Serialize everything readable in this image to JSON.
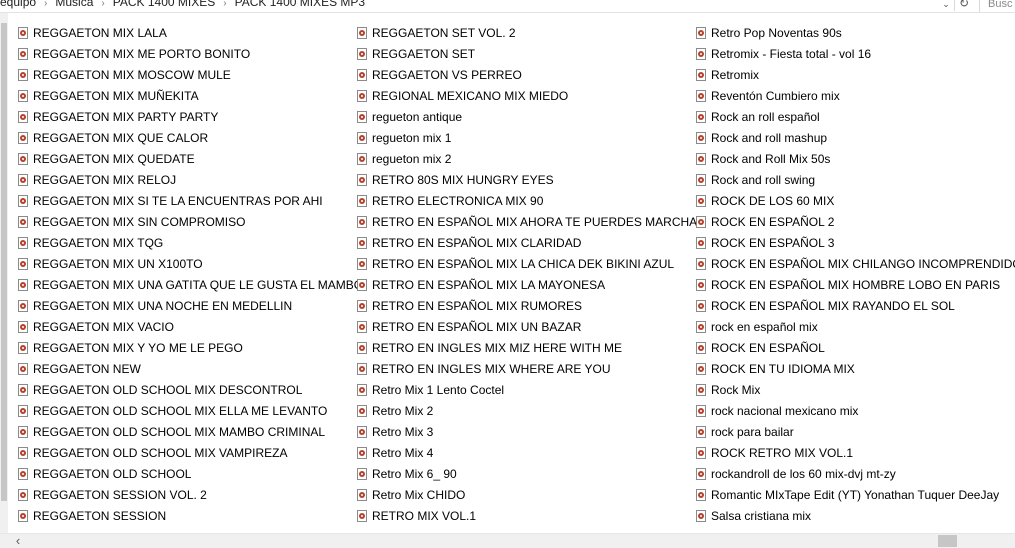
{
  "address_bar": {
    "breadcrumbs": [
      "equipo",
      "Música",
      "PACK 1400 MIXES",
      "PACK 1400 MIXES MP3"
    ],
    "search_placeholder": "Busc"
  },
  "icons": {
    "file": "audio-file-icon",
    "breadcrumb_separator": "chevron-right-icon",
    "address_dropdown": "chevron-down-icon",
    "refresh": "refresh-icon",
    "scroll_left": "chevron-left-icon"
  },
  "colors": {
    "icon_accent": "#b5422c",
    "scrollbar_thumb": "#c6c6c6",
    "scrollbar_track": "#f0f0f0"
  },
  "files": {
    "column_1": [
      "REGGAETON MIX LALA",
      "REGGAETON MIX ME PORTO BONITO",
      "REGGAETON MIX MOSCOW MULE",
      "REGGAETON MIX MUÑEKITA",
      "REGGAETON MIX PARTY PARTY",
      "REGGAETON MIX QUE CALOR",
      "REGGAETON MIX QUEDATE",
      "REGGAETON MIX RELOJ",
      "REGGAETON MIX SI TE LA ENCUENTRAS POR AHI",
      "REGGAETON MIX SIN COMPROMISO",
      "REGGAETON MIX TQG",
      "REGGAETON MIX UN X100TO",
      "REGGAETON MIX UNA GATITA QUE LE GUSTA EL MAMBO",
      "REGGAETON MIX UNA NOCHE EN MEDELLIN",
      "REGGAETON MIX VACIO",
      "REGGAETON MIX Y YO ME LE PEGO",
      "REGGAETON NEW",
      "REGGAETON OLD SCHOOL MIX DESCONTROL",
      "REGGAETON OLD SCHOOL MIX ELLA ME LEVANTO",
      "REGGAETON OLD SCHOOL MIX MAMBO CRIMINAL",
      "REGGAETON OLD SCHOOL MIX VAMPIREZA",
      "REGGAETON OLD SCHOOL",
      "REGGAETON SESSION VOL. 2",
      "REGGAETON SESSION"
    ],
    "column_2": [
      "REGGAETON SET VOL. 2",
      "REGGAETON SET",
      "REGGAETON VS PERREO",
      "REGIONAL MEXICANO MIX MIEDO",
      "regueton antique",
      "regueton mix 1",
      "regueton mix 2",
      "RETRO 80S MIX HUNGRY EYES",
      "RETRO ELECTRONICA MIX 90",
      "RETRO EN ESPAÑOL MIX AHORA TE PUERDES MARCHAR",
      "RETRO EN ESPAÑOL MIX CLARIDAD",
      "RETRO EN ESPAÑOL MIX LA CHICA DEK BIKINI AZUL",
      "RETRO EN ESPAÑOL MIX LA MAYONESA",
      "RETRO EN ESPAÑOL MIX RUMORES",
      "RETRO EN ESPAÑOL MIX UN BAZAR",
      "RETRO EN INGLES MIX MIZ HERE  WITH ME",
      "RETRO EN INGLES MIX WHERE ARE YOU",
      "Retro Mix 1 Lento Coctel",
      "Retro Mix 2",
      "Retro Mix 3",
      "Retro Mix 4",
      "Retro Mix 6_ 90",
      "Retro Mix CHIDO",
      "RETRO MIX VOL.1"
    ],
    "column_3": [
      "Retro Pop Noventas 90s",
      "Retromix - Fiesta total - vol 16",
      "Retromix",
      "Reventón Cumbiero mix",
      "Rock an roll español",
      "Rock and roll mashup",
      "Rock and Roll Mix 50s",
      "Rock and roll swing",
      "ROCK DE LOS 60 MIX",
      "ROCK EN ESPAÑOL 2",
      "ROCK EN ESPAÑOL 3",
      "ROCK EN ESPAÑOL MIX CHILANGO INCOMPRENDIDO",
      "ROCK EN ESPAÑOL MIX HOMBRE LOBO EN PARIS",
      "ROCK EN ESPAÑOL MIX RAYANDO EL SOL",
      "rock en español mix",
      "ROCK EN ESPAÑOL",
      "ROCK EN TU IDIOMA MIX",
      "Rock Mix",
      "rock nacional mexicano mix",
      "rock para bailar",
      "ROCK RETRO MIX VOL.1",
      "rockandroll de los 60 mix-dvj mt-zy",
      "Romantic MIxTape Edit (YT) Yonathan Tuquer DeeJay",
      "Salsa cristiana mix"
    ]
  }
}
